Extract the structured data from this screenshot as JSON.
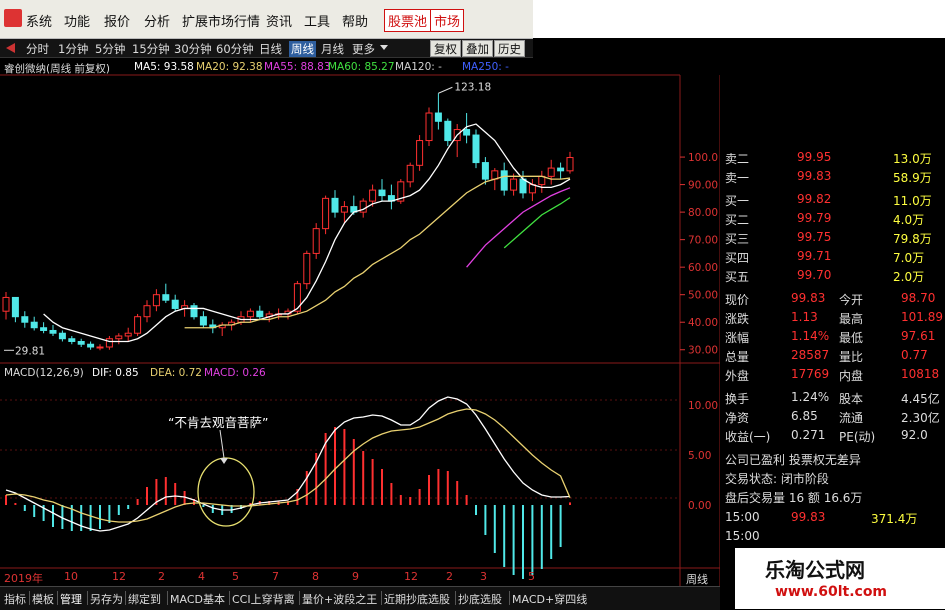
{
  "menu": {
    "items": [
      "系统",
      "功能",
      "报价",
      "分析",
      "扩展市场行情",
      "资讯",
      "工具",
      "帮助"
    ],
    "highlight_items": [
      "股票池",
      "市场"
    ]
  },
  "periods": {
    "items": [
      "分时",
      "1分钟",
      "5分钟",
      "15分钟",
      "30分钟",
      "60分钟",
      "日线",
      "周线",
      "月线",
      "更多"
    ],
    "active": "周线",
    "buttons": [
      "复权",
      "叠加",
      "历史"
    ]
  },
  "price_legend": {
    "name": "睿创微纳(周线 前复权)",
    "ma5": "MA5: 93.58",
    "ma20": "MA20: 92.38",
    "ma55": "MA55: 88.83",
    "ma60": "MA60: 85.27",
    "ma120": "MA120: -",
    "ma250": "MA250: -",
    "colors": {
      "ma5": "#ffffff",
      "ma20": "#e8d070",
      "ma55": "#e040e0",
      "ma60": "#40e040",
      "ma120": "#d0d0d0",
      "ma250": "#4060ff"
    }
  },
  "macd_legend": {
    "name": "MACD(12,26,9)",
    "dif": "DIF: 0.85",
    "dea": "DEA: 0.72",
    "macd": "MACD: 0.26"
  },
  "annotation": "“不肯去观音菩萨”",
  "price_marks": {
    "high": "123.18",
    "low": "29.81"
  },
  "price_axis": [
    "100.0",
    "90.00",
    "80.00",
    "70.00",
    "60.00",
    "50.00",
    "40.00",
    "30.00"
  ],
  "macd_axis": [
    "10.00",
    "5.00",
    "0.00"
  ],
  "time_axis": [
    "2019年",
    "10",
    "12",
    "2",
    "4",
    "5",
    "7",
    "8",
    "9",
    "12",
    "2",
    "3",
    "5"
  ],
  "quote": {
    "sell": [
      {
        "label": "卖二",
        "price": "99.95",
        "vol": "13.0万"
      },
      {
        "label": "卖一",
        "price": "99.83",
        "vol": "58.9万"
      }
    ],
    "buy": [
      {
        "label": "买一",
        "price": "99.82",
        "vol": "11.0万"
      },
      {
        "label": "买二",
        "price": "99.79",
        "vol": "4.0万"
      },
      {
        "label": "买三",
        "price": "99.75",
        "vol": "79.8万"
      },
      {
        "label": "买四",
        "price": "99.71",
        "vol": "7.0万"
      },
      {
        "label": "买五",
        "price": "99.70",
        "vol": "2.0万"
      }
    ],
    "stats": [
      {
        "l1": "现价",
        "v1": "99.83",
        "l2": "今开",
        "v2": "98.70"
      },
      {
        "l1": "涨跌",
        "v1": "1.13",
        "l2": "最高",
        "v2": "101.89"
      },
      {
        "l1": "涨幅",
        "v1": "1.14%",
        "l2": "最低",
        "v2": "97.61"
      },
      {
        "l1": "总量",
        "v1": "28587",
        "l2": "量比",
        "v2": "0.77"
      },
      {
        "l1": "外盘",
        "v1": "17769",
        "l2": "内盘",
        "v2": "10818"
      }
    ],
    "stats2": [
      {
        "l1": "换手",
        "v1": "1.24%",
        "l2": "股本",
        "v2": "4.45亿"
      },
      {
        "l1": "净资",
        "v1": "6.85",
        "l2": "流通",
        "v2": "2.30亿"
      },
      {
        "l1": "收益(一)",
        "v1": "0.271",
        "l2": "PE(动)",
        "v2": "92.0"
      }
    ],
    "info1": "公司已盈利 投票权无差异",
    "info2": "交易状态: 闭市阶段",
    "info3": "盘后交易量 16 额 16.6万",
    "tick": {
      "time": "15:00",
      "price": "99.83",
      "vol": "371.4万"
    },
    "tick2": {
      "time": "15:00"
    }
  },
  "bottom_tabs": [
    "指标",
    "模板",
    "管理",
    "另存为",
    "绑定到",
    "MACD基本",
    "CCI上穿背离",
    "量价+波段之王",
    "近期抄底选股",
    "抄底选股",
    "MACD+穿四线"
  ],
  "bottom_active": "管理",
  "period_label": "周线",
  "watermark": {
    "title": "乐淘公式网",
    "url": "www.60lt.com"
  },
  "chart_data": {
    "type": "candlestick",
    "title": "睿创微纳(周线 前复权)",
    "ylim": [
      27,
      128
    ],
    "candles": [
      [
        44,
        51,
        41,
        49
      ],
      [
        49,
        49,
        40,
        42
      ],
      [
        42,
        44,
        38,
        40
      ],
      [
        40,
        42,
        37,
        38
      ],
      [
        38,
        40,
        36,
        37
      ],
      [
        37,
        39,
        35,
        36
      ],
      [
        36,
        37,
        33,
        34
      ],
      [
        34,
        35,
        32,
        33
      ],
      [
        33,
        34,
        31,
        32
      ],
      [
        32,
        33,
        30,
        31
      ],
      [
        31,
        32,
        29.8,
        31
      ],
      [
        31,
        35,
        30,
        34
      ],
      [
        34,
        36,
        32,
        35
      ],
      [
        35,
        38,
        33,
        36
      ],
      [
        36,
        43,
        35,
        42
      ],
      [
        42,
        48,
        40,
        46
      ],
      [
        46,
        52,
        44,
        50
      ],
      [
        50,
        54,
        47,
        48
      ],
      [
        48,
        50,
        44,
        45
      ],
      [
        45,
        48,
        42,
        46
      ],
      [
        46,
        47,
        41,
        42
      ],
      [
        42,
        44,
        38,
        39
      ],
      [
        39,
        41,
        36,
        38
      ],
      [
        38,
        40,
        35,
        39
      ],
      [
        39,
        41,
        37,
        40
      ],
      [
        40,
        44,
        39,
        42
      ],
      [
        42,
        45,
        40,
        44
      ],
      [
        44,
        46,
        41,
        42
      ],
      [
        42,
        44,
        40,
        43
      ],
      [
        43,
        45,
        41,
        43
      ],
      [
        43,
        45,
        41,
        44
      ],
      [
        44,
        55,
        43,
        54
      ],
      [
        54,
        66,
        52,
        65
      ],
      [
        65,
        76,
        63,
        74
      ],
      [
        74,
        86,
        72,
        85
      ],
      [
        85,
        88,
        78,
        80
      ],
      [
        80,
        84,
        76,
        82
      ],
      [
        82,
        86,
        79,
        80
      ],
      [
        80,
        85,
        78,
        84
      ],
      [
        84,
        90,
        82,
        88
      ],
      [
        88,
        92,
        84,
        86
      ],
      [
        86,
        90,
        81,
        84
      ],
      [
        84,
        92,
        83,
        91
      ],
      [
        91,
        98,
        89,
        97
      ],
      [
        97,
        108,
        95,
        106
      ],
      [
        106,
        118,
        104,
        116
      ],
      [
        116,
        123.18,
        110,
        113
      ],
      [
        113,
        114,
        104,
        106
      ],
      [
        106,
        112,
        100,
        110
      ],
      [
        110,
        116,
        105,
        108
      ],
      [
        108,
        110,
        96,
        98
      ],
      [
        98,
        100,
        90,
        92
      ],
      [
        92,
        96,
        88,
        95
      ],
      [
        95,
        98,
        86,
        88
      ],
      [
        88,
        94,
        86,
        92
      ],
      [
        92,
        95,
        85,
        87
      ],
      [
        87,
        92,
        84,
        90
      ],
      [
        90,
        95,
        87,
        93
      ],
      [
        93,
        99,
        90,
        96
      ],
      [
        96,
        98,
        92,
        95
      ],
      [
        95,
        101.89,
        94,
        99.83
      ]
    ],
    "ma5": [
      null,
      null,
      null,
      null,
      43,
      40,
      38,
      37,
      36,
      35,
      34,
      33,
      33,
      33,
      34,
      36,
      39,
      42,
      44,
      45,
      45,
      45,
      44,
      43,
      42,
      41,
      41,
      41,
      42,
      43,
      43,
      45,
      49,
      55,
      62,
      70,
      76,
      80,
      81,
      83,
      84,
      84,
      85,
      86,
      88,
      92,
      97,
      103,
      108,
      111,
      112,
      109,
      106,
      101,
      96,
      92,
      90,
      89,
      89,
      90,
      92
    ],
    "ma20": [
      null,
      null,
      null,
      null,
      null,
      null,
      null,
      null,
      null,
      null,
      null,
      null,
      null,
      null,
      null,
      null,
      null,
      null,
      null,
      38,
      38,
      38,
      38,
      39,
      39,
      40,
      40,
      41,
      41,
      42,
      42,
      43,
      44,
      46,
      48,
      51,
      53,
      56,
      58,
      61,
      63,
      65,
      67,
      70,
      72,
      75,
      78,
      81,
      84,
      87,
      89,
      91,
      92,
      93,
      93,
      93,
      93,
      93,
      92,
      92,
      92.38
    ],
    "ma55": [
      null,
      null,
      null,
      null,
      null,
      null,
      null,
      null,
      null,
      null,
      null,
      null,
      null,
      null,
      null,
      null,
      null,
      null,
      null,
      null,
      null,
      null,
      null,
      null,
      null,
      null,
      null,
      null,
      null,
      null,
      null,
      null,
      null,
      null,
      null,
      null,
      null,
      null,
      null,
      null,
      null,
      null,
      null,
      null,
      null,
      null,
      null,
      null,
      null,
      60,
      64,
      68,
      71,
      74,
      77,
      80,
      82,
      84,
      86,
      87.5,
      88.83
    ],
    "ma60": [
      null,
      null,
      null,
      null,
      null,
      null,
      null,
      null,
      null,
      null,
      null,
      null,
      null,
      null,
      null,
      null,
      null,
      null,
      null,
      null,
      null,
      null,
      null,
      null,
      null,
      null,
      null,
      null,
      null,
      null,
      null,
      null,
      null,
      null,
      null,
      null,
      null,
      null,
      null,
      null,
      null,
      null,
      null,
      null,
      null,
      null,
      null,
      null,
      null,
      null,
      null,
      null,
      null,
      67,
      70,
      73,
      76,
      79,
      81,
      83,
      85.27
    ],
    "macd_ylim": [
      -6,
      13
    ],
    "dif": [
      1.5,
      1.2,
      0.7,
      0.2,
      -0.3,
      -0.8,
      -1.3,
      -1.7,
      -2.1,
      -2.4,
      -2.6,
      -2.5,
      -2.2,
      -1.9,
      -1.3,
      -0.5,
      0.3,
      0.8,
      0.9,
      0.8,
      0.5,
      0.1,
      -0.3,
      -0.5,
      -0.5,
      -0.3,
      0.0,
      0.2,
      0.3,
      0.4,
      0.5,
      1.3,
      2.7,
      4.3,
      6.2,
      7.5,
      8.3,
      8.7,
      8.8,
      9.0,
      8.9,
      8.5,
      8.0,
      8.0,
      8.6,
      9.7,
      10.4,
      10.8,
      10.6,
      10.1,
      9.0,
      7.6,
      6.1,
      4.6,
      3.3,
      2.2,
      1.5,
      1.0,
      0.8,
      0.8,
      0.85
    ],
    "dea": [
      1.0,
      1.1,
      1.0,
      0.8,
      0.5,
      0.3,
      -0.1,
      -0.4,
      -0.8,
      -1.1,
      -1.4,
      -1.6,
      -1.7,
      -1.7,
      -1.6,
      -1.4,
      -1.0,
      -0.6,
      -0.2,
      0.1,
      0.2,
      0.2,
      0.1,
      0.0,
      -0.1,
      -0.1,
      -0.1,
      0.0,
      0.1,
      0.2,
      0.3,
      0.5,
      1.0,
      1.7,
      2.6,
      3.6,
      4.5,
      5.4,
      6.1,
      6.7,
      7.1,
      7.4,
      7.5,
      7.6,
      7.8,
      8.2,
      8.6,
      9.1,
      9.4,
      9.6,
      9.5,
      9.1,
      8.5,
      7.7,
      6.8,
      5.9,
      5.0,
      4.2,
      3.5,
      2.9,
      0.72
    ]
  }
}
